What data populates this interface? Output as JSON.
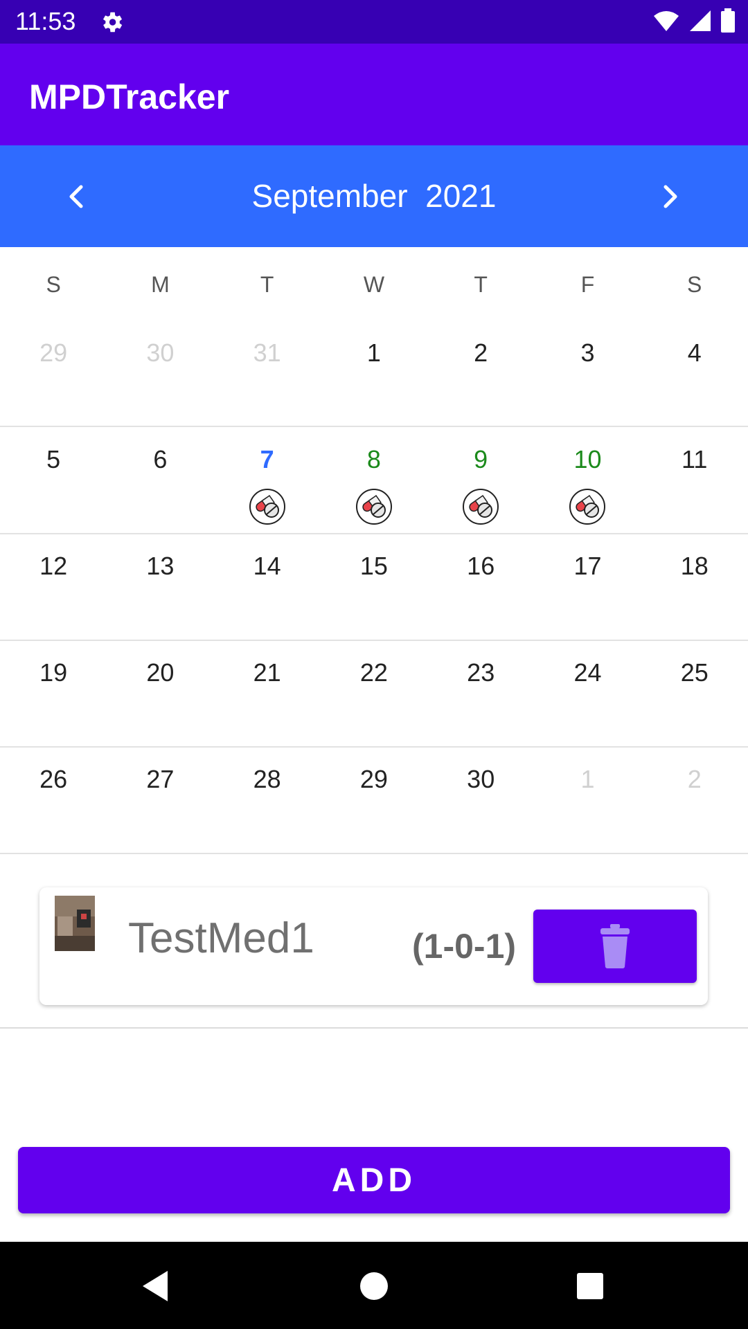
{
  "status": {
    "time": "11:53"
  },
  "app": {
    "title": "MPDTracker"
  },
  "calendar": {
    "month": "September",
    "year": "2021",
    "weekdays": [
      "S",
      "M",
      "T",
      "W",
      "T",
      "F",
      "S"
    ],
    "weeks": [
      [
        {
          "d": "29",
          "state": "muted"
        },
        {
          "d": "30",
          "state": "muted"
        },
        {
          "d": "31",
          "state": "muted"
        },
        {
          "d": "1"
        },
        {
          "d": "2"
        },
        {
          "d": "3"
        },
        {
          "d": "4"
        }
      ],
      [
        {
          "d": "5"
        },
        {
          "d": "6"
        },
        {
          "d": "7",
          "state": "today",
          "pill": true
        },
        {
          "d": "8",
          "state": "green",
          "pill": true
        },
        {
          "d": "9",
          "state": "green",
          "pill": true
        },
        {
          "d": "10",
          "state": "green",
          "pill": true
        },
        {
          "d": "11"
        }
      ],
      [
        {
          "d": "12"
        },
        {
          "d": "13"
        },
        {
          "d": "14"
        },
        {
          "d": "15"
        },
        {
          "d": "16"
        },
        {
          "d": "17"
        },
        {
          "d": "18"
        }
      ],
      [
        {
          "d": "19"
        },
        {
          "d": "20"
        },
        {
          "d": "21"
        },
        {
          "d": "22"
        },
        {
          "d": "23"
        },
        {
          "d": "24"
        },
        {
          "d": "25"
        }
      ],
      [
        {
          "d": "26"
        },
        {
          "d": "27"
        },
        {
          "d": "28"
        },
        {
          "d": "29"
        },
        {
          "d": "30"
        },
        {
          "d": "1",
          "state": "muted"
        },
        {
          "d": "2",
          "state": "muted"
        }
      ]
    ]
  },
  "medication": {
    "name": "TestMed1",
    "dose": "(1-0-1)"
  },
  "actions": {
    "add_label": "ADD"
  },
  "colors": {
    "status_bar": "#3700b3",
    "primary": "#6200ee",
    "calendar_header": "#2f6bff",
    "today": "#2f6bff",
    "taken": "#1b8a1b"
  },
  "icons": {
    "status": [
      "gear-icon",
      "wifi-icon",
      "cell-signal-icon",
      "battery-icon"
    ],
    "calendar_marker": "pill-icon",
    "delete": "trash-icon"
  }
}
